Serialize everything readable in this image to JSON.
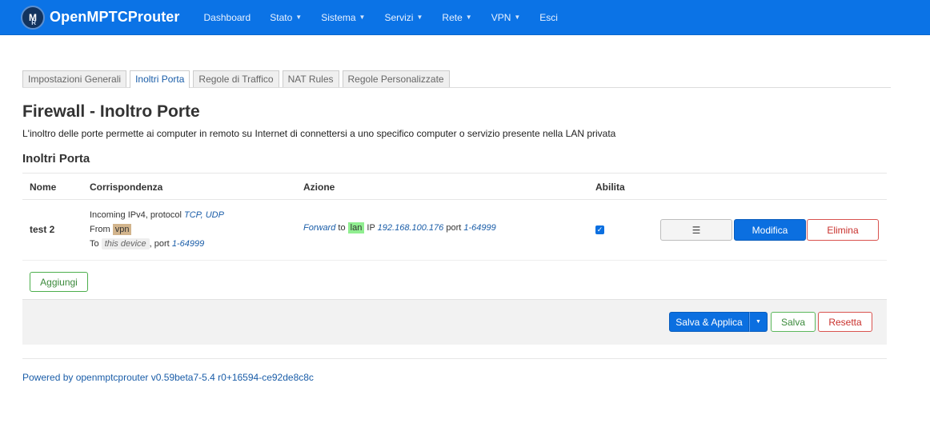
{
  "brand": {
    "name": "OpenMPTCProuter",
    "logo_letter": "M",
    "logo_sub": "R"
  },
  "nav": [
    {
      "label": "Dashboard",
      "dropdown": false
    },
    {
      "label": "Stato",
      "dropdown": true
    },
    {
      "label": "Sistema",
      "dropdown": true
    },
    {
      "label": "Servizi",
      "dropdown": true
    },
    {
      "label": "Rete",
      "dropdown": true
    },
    {
      "label": "VPN",
      "dropdown": true
    },
    {
      "label": "Esci",
      "dropdown": false
    }
  ],
  "tabs": [
    {
      "label": "Impostazioni Generali",
      "active": false
    },
    {
      "label": "Inoltri Porta",
      "active": true
    },
    {
      "label": "Regole di Traffico",
      "active": false
    },
    {
      "label": "NAT Rules",
      "active": false
    },
    {
      "label": "Regole Personalizzate",
      "active": false
    }
  ],
  "page": {
    "title": "Firewall - Inoltro Porte",
    "description": "L'inoltro delle porte permette ai computer in remoto su Internet di connettersi a uno specifico computer o servizio presente nella LAN privata",
    "section_title": "Inoltri Porta"
  },
  "table": {
    "headers": {
      "name": "Nome",
      "match": "Corrispondenza",
      "action": "Azione",
      "enable": "Abilita"
    },
    "rows": [
      {
        "name": "test 2",
        "match": {
          "incoming": "Incoming IPv4, protocol",
          "protocols": "TCP, UDP",
          "from_label": "From",
          "from_zone": "vpn",
          "to_label": "To",
          "to_device": "this device",
          "port_label": ", port",
          "port_range": "1-64999"
        },
        "action": {
          "verb": "Forward",
          "to_label": "to",
          "zone": "lan",
          "ip_label": "IP",
          "ip": "192.168.100.176",
          "port_label": "port",
          "port_range": "1-64999"
        },
        "enabled": true,
        "buttons": {
          "menu": "☰",
          "edit": "Modifica",
          "delete": "Elimina"
        }
      }
    ]
  },
  "add_button": "Aggiungi",
  "footer_actions": {
    "save_apply": "Salva & Applica",
    "save": "Salva",
    "reset": "Resetta"
  },
  "powered_by": "Powered by openmptcprouter v0.59beta7-5.4 r0+16594-ce92de8c8c",
  "colors": {
    "nav": "#0b73e6",
    "primary": "#0b6fe0",
    "zone_vpn": "#d2b48c",
    "zone_lan": "#90ee90",
    "danger": "#d9534f",
    "success": "#5cb85c"
  }
}
